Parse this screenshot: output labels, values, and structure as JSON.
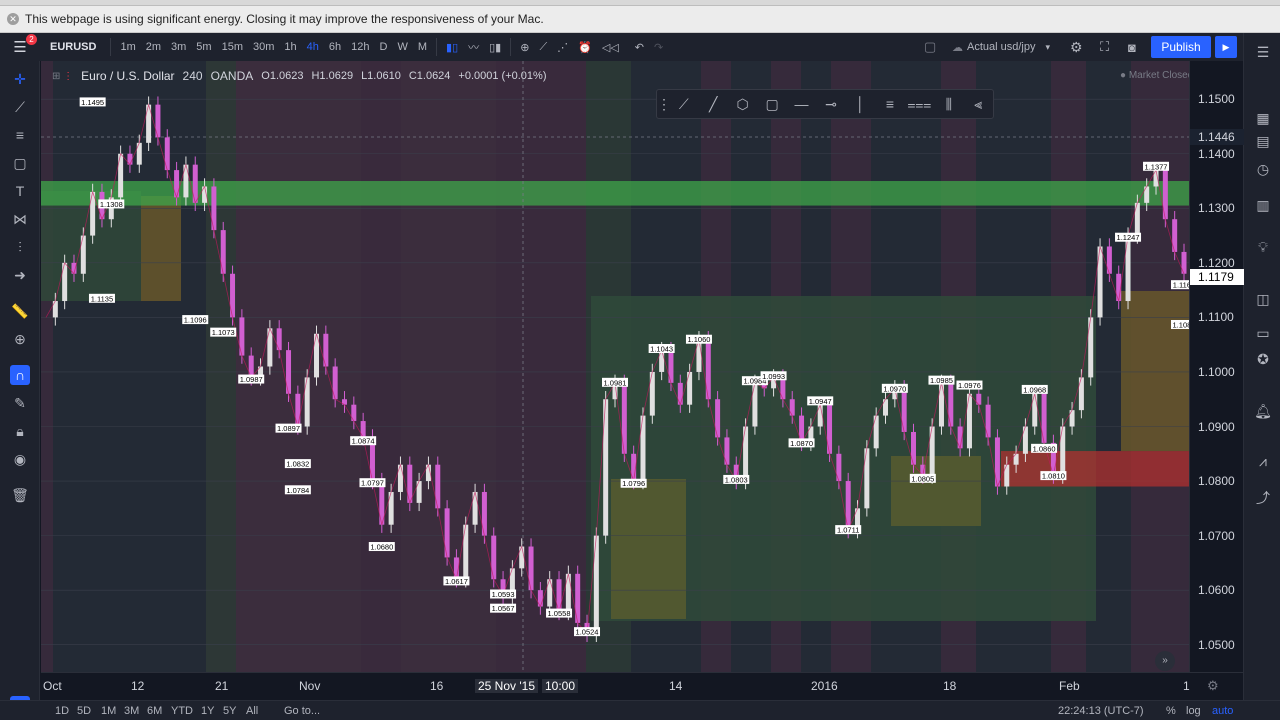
{
  "notice": {
    "text": "This webpage is using significant energy. Closing it may improve the responsiveness of your Mac."
  },
  "topbar": {
    "symbol": "EURUSD",
    "intervals": [
      "1m",
      "2m",
      "3m",
      "5m",
      "15m",
      "30m",
      "1h",
      "4h",
      "6h",
      "12h",
      "D",
      "W",
      "M"
    ],
    "active_interval": "4h",
    "compare_label": "Actual usd/jpy",
    "publish_label": "Publish",
    "notification_count": "2"
  },
  "legend": {
    "name": "Euro / U.S. Dollar",
    "interval": "240",
    "source": "OANDA",
    "open": "O1.0623",
    "high": "H1.0629",
    "low": "L1.0610",
    "close": "C1.0624",
    "change": "+0.0001 (+0.01%)",
    "market_status": "Market Closed"
  },
  "price_axis": {
    "ticks": [
      "1.1500",
      "1.1400",
      "1.1300",
      "1.1200",
      "1.1100",
      "1.1000",
      "1.0900",
      "1.0800",
      "1.0700",
      "1.0600",
      "1.0500"
    ],
    "crosshair_price": "1.1446",
    "current_price": "1.1179"
  },
  "time_axis": {
    "ticks": [
      "Oct",
      "12",
      "21",
      "Nov",
      "16",
      "25 Nov '15",
      "10:00",
      "14",
      "2016",
      "18",
      "Feb",
      "1"
    ]
  },
  "bottombar": {
    "ranges": [
      "1D",
      "5D",
      "1M",
      "3M",
      "6M",
      "YTD",
      "1Y",
      "5Y",
      "All"
    ],
    "goto": "Go to...",
    "clock": "22:24:13 (UTC-7)",
    "percent": "%",
    "log": "log",
    "auto": "auto"
  },
  "chart_data": {
    "type": "candlestick",
    "title": "Euro / U.S. Dollar",
    "ylim": [
      1.045,
      1.157
    ],
    "price_labels": [
      {
        "t": 0.3,
        "text": "1.1495"
      },
      {
        "t": 0.35,
        "text": "1.1308"
      },
      {
        "t": 0.05,
        "text": "1.1135"
      },
      {
        "t": 0.6,
        "text": "1.1096"
      },
      {
        "t": 0.8,
        "text": "1.1073"
      },
      {
        "t": 0.5,
        "text": "1.0987"
      },
      {
        "t": 0.65,
        "text": "1.0897"
      },
      {
        "t": 0.95,
        "text": "1.0832"
      },
      {
        "t": 0.85,
        "text": "1.0784"
      },
      {
        "t": 0.8,
        "text": "1.0797"
      },
      {
        "t": 0.9,
        "text": "1.0874"
      },
      {
        "t": 1.0,
        "text": "1.0680"
      },
      {
        "t": 0.7,
        "text": "1.0617"
      },
      {
        "t": 0.8,
        "text": "1.0593"
      },
      {
        "t": 0.9,
        "text": "1.0567"
      },
      {
        "t": 0.9,
        "text": "1.0558"
      },
      {
        "t": 0.9,
        "text": "1.0524"
      },
      {
        "t": 0.9,
        "text": "1.0981"
      },
      {
        "t": 0.9,
        "text": "1.0796"
      },
      {
        "t": 0.9,
        "text": "1.1043"
      },
      {
        "t": 0.9,
        "text": "1.1060"
      },
      {
        "t": 0.9,
        "text": "1.0803"
      },
      {
        "t": 0.9,
        "text": "1.0984"
      },
      {
        "t": 0.9,
        "text": "1.0993"
      },
      {
        "t": 0.9,
        "text": "1.0870"
      },
      {
        "t": 0.9,
        "text": "1.0947"
      },
      {
        "t": 0.9,
        "text": "1.0711"
      },
      {
        "t": 0.9,
        "text": "1.0970"
      },
      {
        "t": 0.9,
        "text": "1.0985"
      },
      {
        "t": 0.9,
        "text": "1.0805"
      },
      {
        "t": 0.9,
        "text": "1.0976"
      },
      {
        "t": 0.9,
        "text": "1.0860"
      },
      {
        "t": 0.9,
        "text": "1.0968"
      },
      {
        "t": 0.9,
        "text": "1.0810"
      },
      {
        "t": 0.9,
        "text": "1.1247"
      },
      {
        "t": 0.9,
        "text": "1.1377"
      },
      {
        "t": 0.9,
        "text": "1.1160"
      },
      {
        "t": 0.9,
        "text": "1.1087"
      }
    ],
    "path": [
      1.11,
      1.113,
      1.12,
      1.118,
      1.125,
      1.133,
      1.128,
      1.132,
      1.14,
      1.138,
      1.142,
      1.149,
      1.143,
      1.137,
      1.132,
      1.138,
      1.131,
      1.134,
      1.126,
      1.118,
      1.11,
      1.103,
      1.099,
      1.101,
      1.108,
      1.104,
      1.096,
      1.09,
      1.099,
      1.107,
      1.101,
      1.095,
      1.094,
      1.091,
      1.088,
      1.08,
      1.072,
      1.078,
      1.083,
      1.076,
      1.08,
      1.083,
      1.075,
      1.066,
      1.062,
      1.072,
      1.078,
      1.07,
      1.062,
      1.059,
      1.064,
      1.068,
      1.06,
      1.057,
      1.062,
      1.056,
      1.063,
      1.054,
      1.052,
      1.07,
      1.095,
      1.098,
      1.085,
      1.08,
      1.092,
      1.1,
      1.104,
      1.098,
      1.094,
      1.1,
      1.106,
      1.095,
      1.088,
      1.083,
      1.08,
      1.09,
      1.098,
      1.097,
      1.099,
      1.095,
      1.092,
      1.087,
      1.09,
      1.094,
      1.085,
      1.08,
      1.071,
      1.075,
      1.086,
      1.092,
      1.095,
      1.097,
      1.089,
      1.083,
      1.081,
      1.09,
      1.098,
      1.09,
      1.086,
      1.096,
      1.094,
      1.088,
      1.079,
      1.083,
      1.085,
      1.09,
      1.096,
      1.087,
      1.081,
      1.09,
      1.093,
      1.099,
      1.11,
      1.123,
      1.118,
      1.113,
      1.125,
      1.131,
      1.134,
      1.137,
      1.128,
      1.122,
      1.118
    ],
    "zones": {
      "resistance_band": [
        1.1305,
        1.135
      ],
      "support_band": [
        1.079,
        1.0855
      ]
    }
  }
}
